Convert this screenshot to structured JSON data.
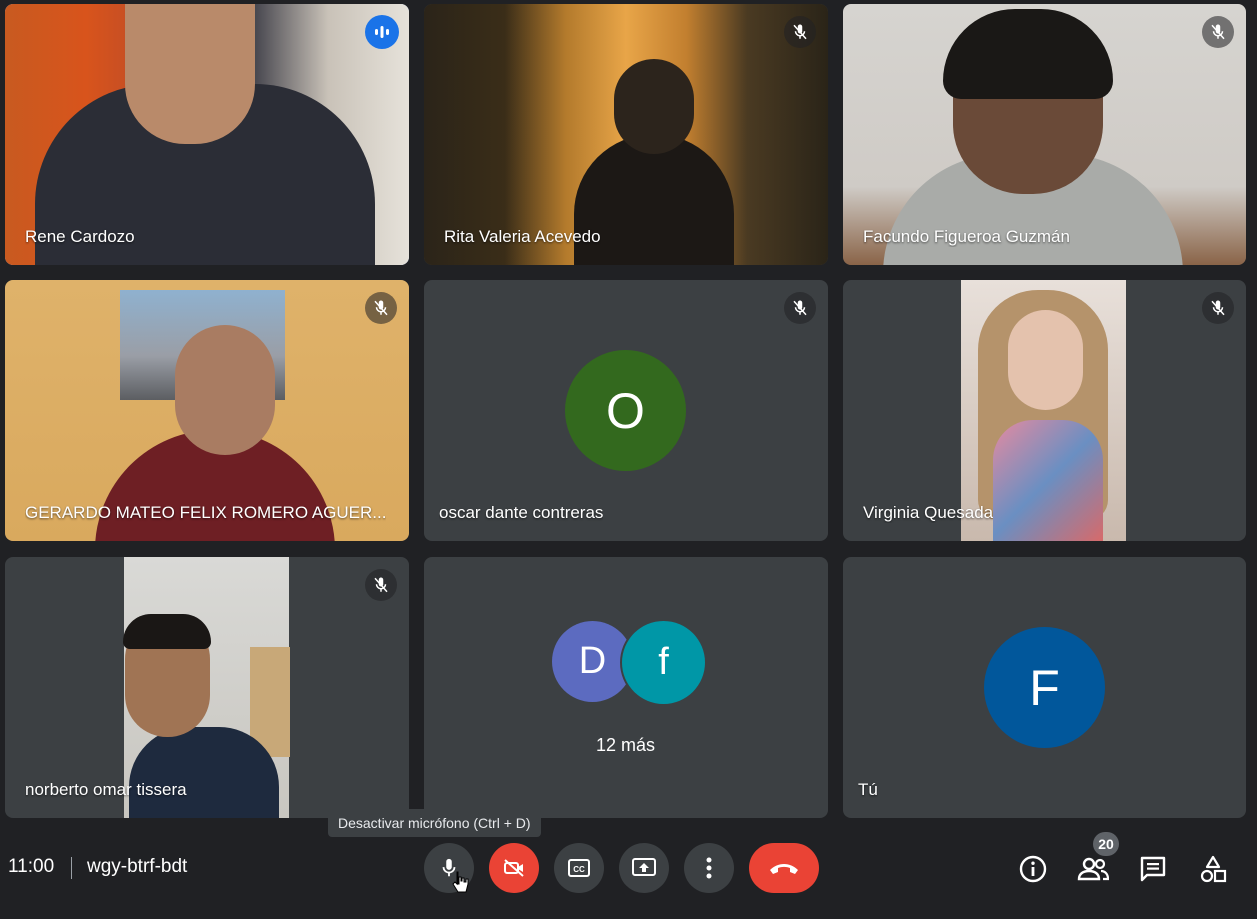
{
  "meeting": {
    "time": "11:00",
    "code": "wgy-btrf-bdt",
    "participant_count": "20",
    "tooltip": "Desactivar micrófono (Ctrl + D)"
  },
  "participants": [
    {
      "name": "Rene Cardozo",
      "speaking": true
    },
    {
      "name": "Rita Valeria Acevedo",
      "muted": true
    },
    {
      "name": "Facundo Figueroa Guzmán",
      "muted": true
    },
    {
      "name": "GERARDO MATEO FELIX ROMERO AGUER...",
      "muted": true
    },
    {
      "name": "oscar dante contreras",
      "muted": true,
      "avatar_letter": "O",
      "avatar_color": "#33691e"
    },
    {
      "name": "Virginia Quesada",
      "muted": true
    },
    {
      "name": "norberto omar tissera",
      "muted": true
    },
    {
      "name": "Tú",
      "avatar_letter": "F",
      "avatar_color": "#01579b"
    }
  ],
  "more_tile": {
    "avatars": [
      {
        "letter": "D",
        "color": "#5c6bc0"
      },
      {
        "letter": "f",
        "color": "#0097a7"
      }
    ],
    "label": "12 más"
  },
  "controls": {
    "icons": [
      "microphone-icon",
      "camera-off-icon",
      "captions-icon",
      "present-screen-icon",
      "more-options-icon",
      "end-call-icon"
    ],
    "right_icons": [
      "info-icon",
      "people-icon",
      "chat-icon",
      "activities-icon"
    ],
    "colors": {
      "accent": "#8ab4f8",
      "speaking": "#1a73e8",
      "danger": "#ea4335",
      "background": "#202124",
      "tile": "#3c4043"
    }
  }
}
